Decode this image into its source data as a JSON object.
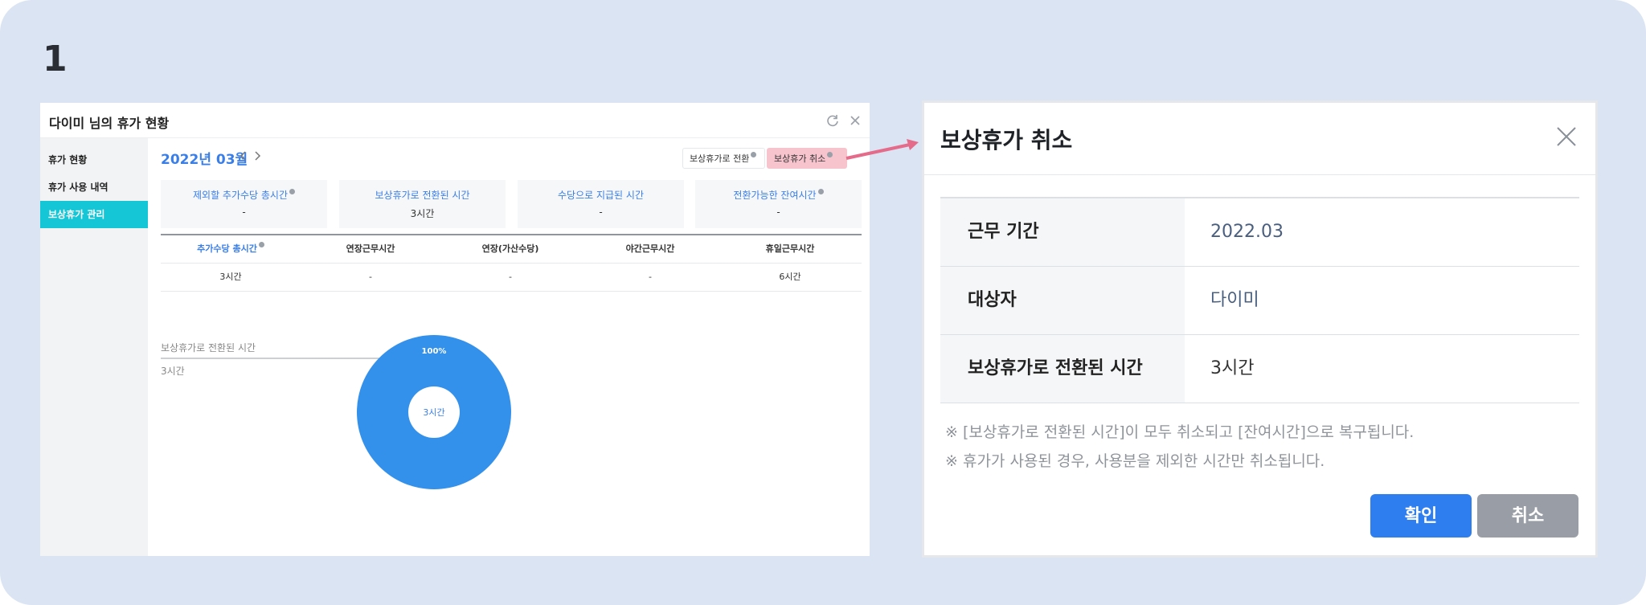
{
  "step": "1",
  "window": {
    "title": "다이미 님의 휴가 현황",
    "refresh_icon": "refresh-icon",
    "close_icon": "close-icon"
  },
  "sidebar": {
    "items": [
      {
        "label": "휴가 현황",
        "active": false
      },
      {
        "label": "휴가 사용 내역",
        "active": false
      },
      {
        "label": "보상휴가 관리",
        "active": true
      }
    ]
  },
  "toolbar": {
    "month": "2022년 03월",
    "convert_label": "보상휴가로 전환",
    "cancel_label": "보상휴가 취소"
  },
  "summary": [
    {
      "label": "제외할 추가수당 총시간",
      "value": "-",
      "info": true
    },
    {
      "label": "보상휴가로 전환된 시간",
      "value": "3시간",
      "info": false
    },
    {
      "label": "수당으로 지급된 시간",
      "value": "-",
      "info": false
    },
    {
      "label": "전환가능한 잔여시간",
      "value": "-",
      "info": true
    }
  ],
  "detail_table": {
    "headers": [
      "추가수당 총시간",
      "연장근무시간",
      "연장(가산수당)",
      "야간근무시간",
      "휴일근무시간"
    ],
    "row": [
      "3시간",
      "-",
      "-",
      "-",
      "6시간"
    ]
  },
  "chart_data": {
    "type": "pie",
    "labels": [
      "보상휴가로 전환된 시간"
    ],
    "values": [
      3
    ],
    "value_labels": [
      "3시간"
    ],
    "percent_labels": [
      "100%"
    ],
    "center_label": "3시간",
    "colors": [
      "#3391ec"
    ]
  },
  "legend": {
    "label": "보상휴가로 전환된 시간",
    "value": "3시간"
  },
  "modal": {
    "title": "보상휴가 취소",
    "rows": [
      {
        "key": "근무 기간",
        "value": "2022.03"
      },
      {
        "key": "대상자",
        "value": "다이미"
      },
      {
        "key": "보상휴가로 전환된 시간",
        "value": "3시간"
      }
    ],
    "notes": [
      "※ [보상휴가로 전환된 시간]이 모두 취소되고 [잔여시간]으로 복구됩니다.",
      "※ 휴가가 사용된 경우, 사용분을 제외한 시간만 취소됩니다."
    ],
    "confirm_label": "확인",
    "cancel_label": "취소"
  },
  "colors": {
    "accent_blue": "#3a7ee8",
    "sidebar_active": "#15c6d6",
    "highlight_pink": "#f7c4cd",
    "arrow_pink": "#e56b8a",
    "confirm_button": "#2f7ef0",
    "cancel_button": "#999ea6"
  }
}
